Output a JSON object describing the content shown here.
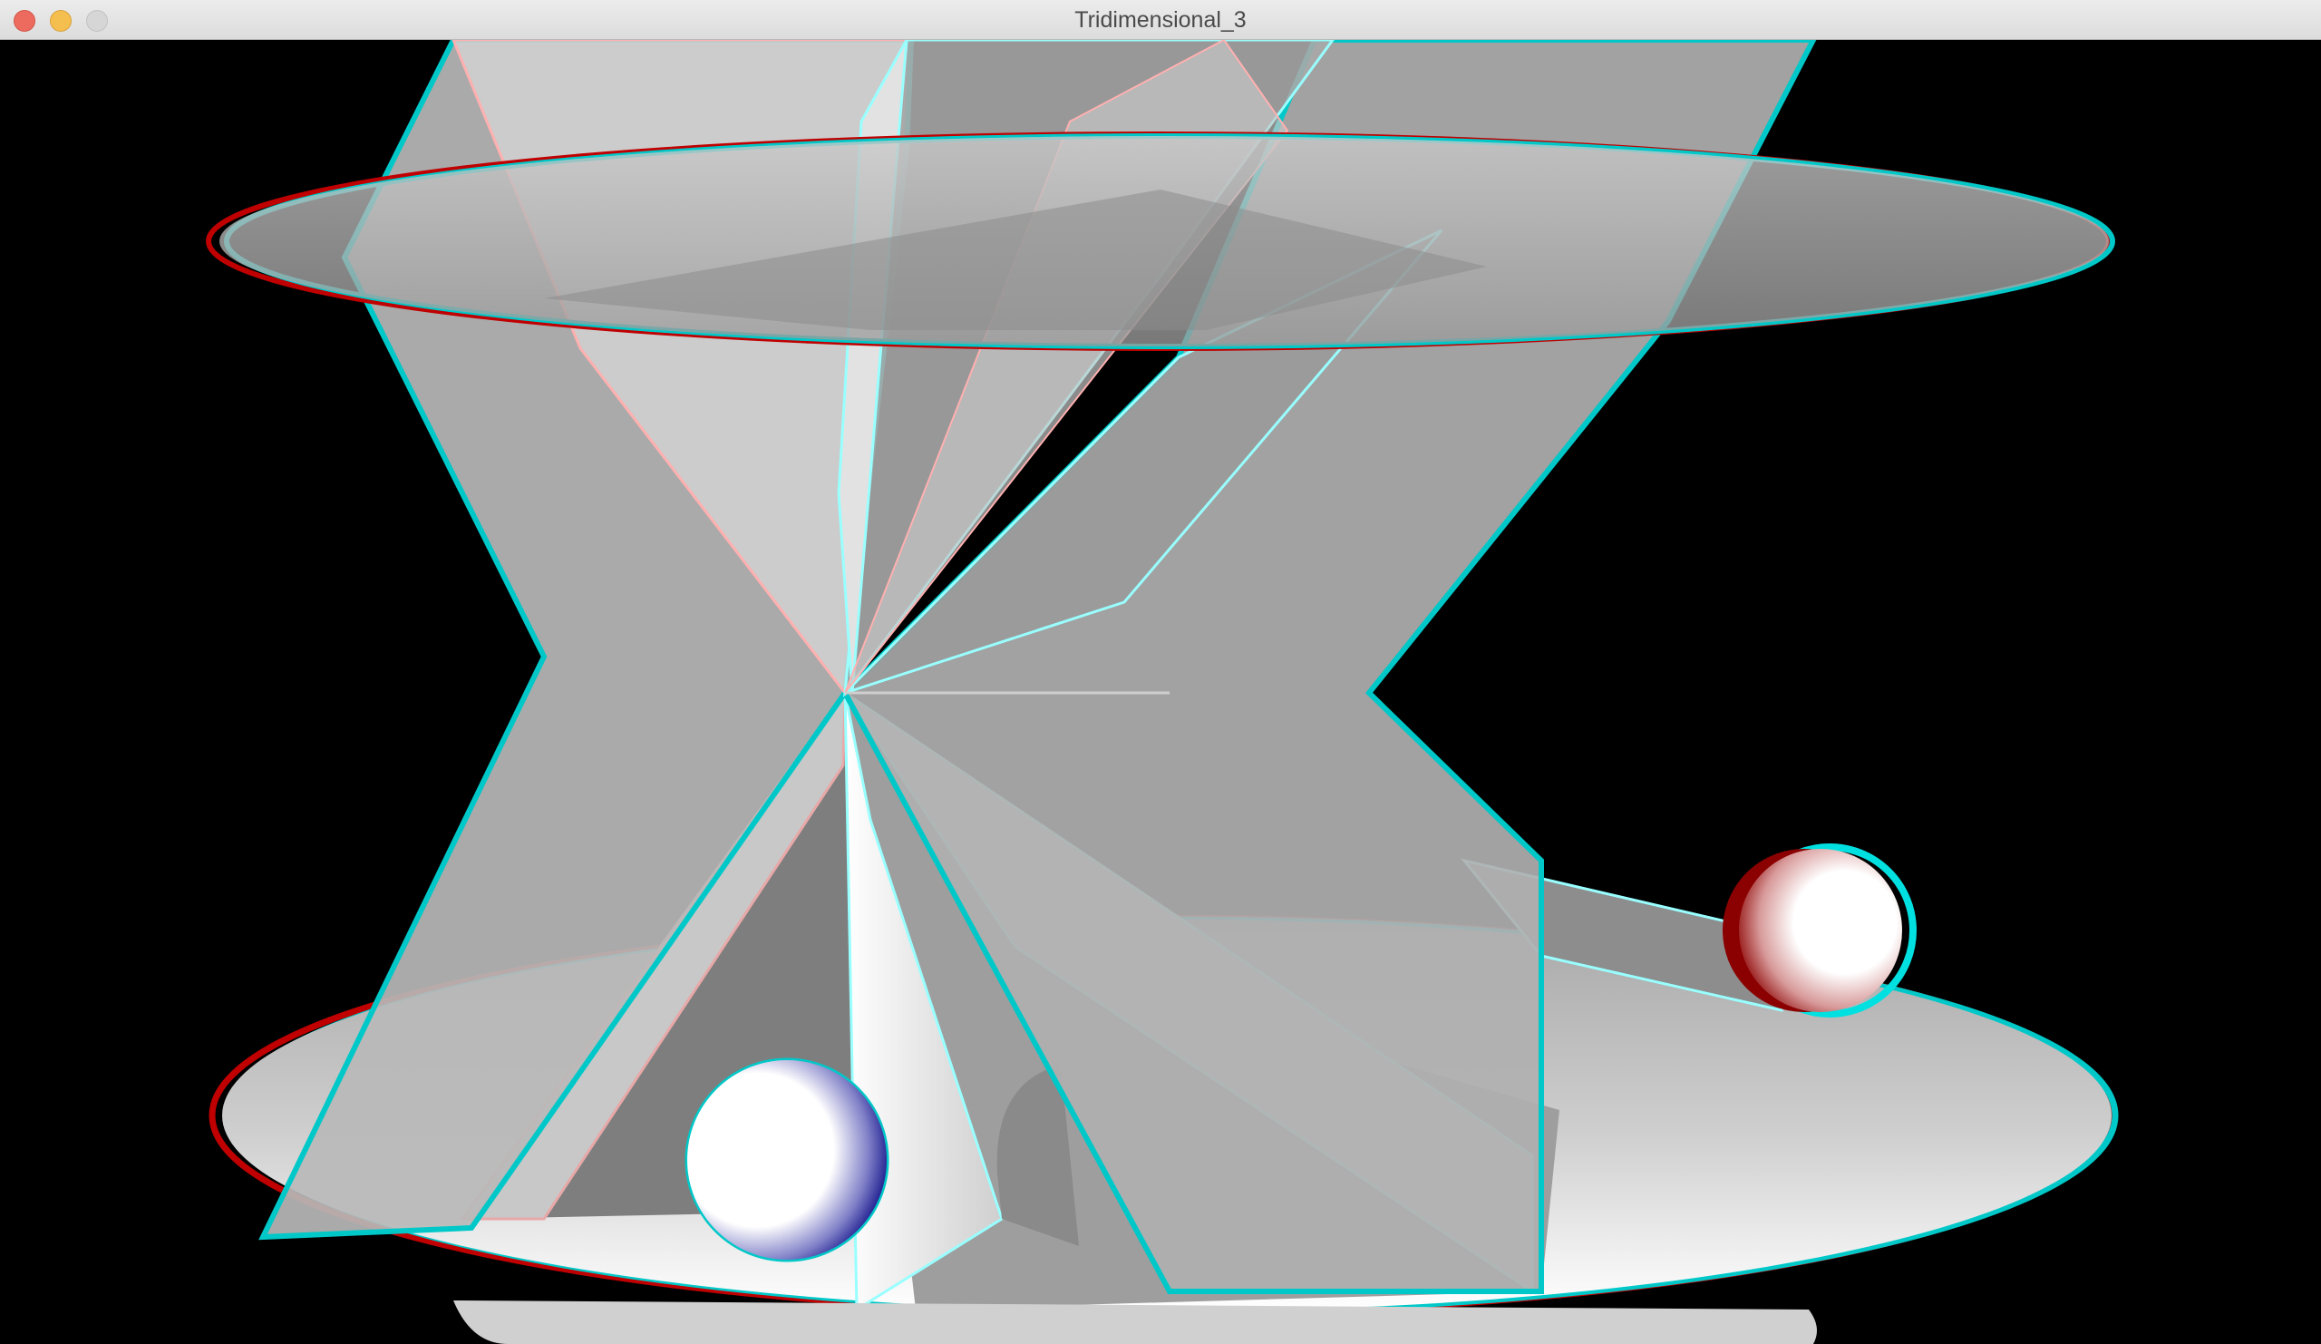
{
  "window": {
    "title": "Tridimensional_3",
    "buttons": {
      "close": "close",
      "minimize": "minimize",
      "zoom": "zoom"
    }
  },
  "scene": {
    "background": "#000000",
    "surface": "#b4b4b4",
    "surface_dark": "#7e7e7e",
    "surface_light": "#ffffff",
    "anaglyph_left": "#c00000",
    "anaglyph_right": "#00c8c8",
    "sphere_left_shade": "#00007f",
    "sphere_right_shade": "#8b0000"
  }
}
